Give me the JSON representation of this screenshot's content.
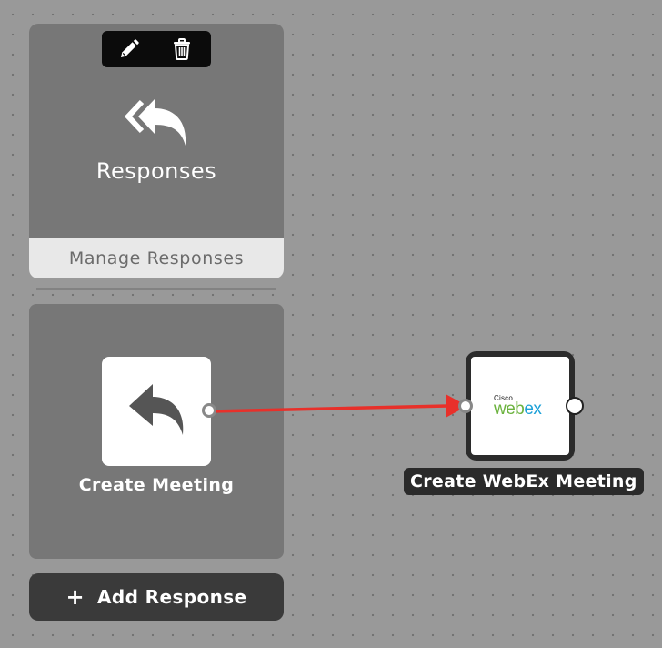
{
  "responses_card": {
    "toolbar": {
      "edit_icon": "pencil-icon",
      "delete_icon": "trash-icon"
    },
    "icon": "reply-all-icon",
    "title": "Responses",
    "manage_label": "Manage Responses"
  },
  "meeting_node": {
    "icon": "reply-icon",
    "label": "Create Meeting"
  },
  "webex_node": {
    "logo": {
      "brand_small": "Cisco",
      "brand_word_part1": "web",
      "brand_word_part2": "ex"
    },
    "label": "Create WebEx Meeting"
  },
  "add_response": {
    "plus_symbol": "+",
    "label": "Add Response"
  },
  "connection": {
    "color": "#e8302a"
  },
  "colors": {
    "canvas": "#999999",
    "panel": "#777777",
    "dark_button": "#3a3a3a",
    "webex_green": "#6cb33f",
    "webex_blue": "#1da1d8"
  }
}
